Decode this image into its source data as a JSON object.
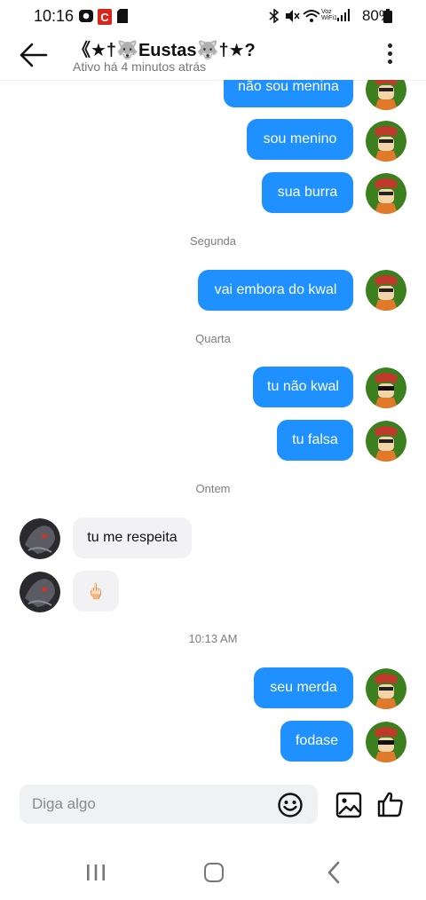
{
  "status_bar": {
    "time": "10:16",
    "network_label": "Voz WiFi1",
    "battery": "80%"
  },
  "header": {
    "title": "《★†🐺Eustas🐺†★?",
    "subtitle": "Ativo há 4 minutos atrás"
  },
  "messages": [
    {
      "type": "outgoing",
      "text": "não sou menina"
    },
    {
      "type": "outgoing",
      "text": "sou menino"
    },
    {
      "type": "outgoing",
      "text": "sua burra"
    },
    {
      "type": "date",
      "text": "Segunda"
    },
    {
      "type": "outgoing",
      "text": "vai embora do kwal"
    },
    {
      "type": "date",
      "text": "Quarta"
    },
    {
      "type": "outgoing",
      "text": "tu não kwal"
    },
    {
      "type": "outgoing",
      "text": "tu falsa"
    },
    {
      "type": "date",
      "text": "Ontem"
    },
    {
      "type": "incoming",
      "text": "tu me respeita"
    },
    {
      "type": "incoming",
      "text": "🖕🏻"
    },
    {
      "type": "date",
      "text": "10:13 AM"
    },
    {
      "type": "outgoing",
      "text": "seu merda"
    },
    {
      "type": "outgoing",
      "text": "fodase"
    }
  ],
  "input": {
    "placeholder": "Diga algo",
    "value": ""
  },
  "icons": {
    "back": "arrow-left-icon",
    "menu": "kebab-menu-icon",
    "emoji": "emoji-icon",
    "image": "image-icon",
    "like": "thumbs-up-icon"
  },
  "colors": {
    "outgoing_bubble": "#1e90ff",
    "incoming_bubble": "#f2f2f4"
  }
}
